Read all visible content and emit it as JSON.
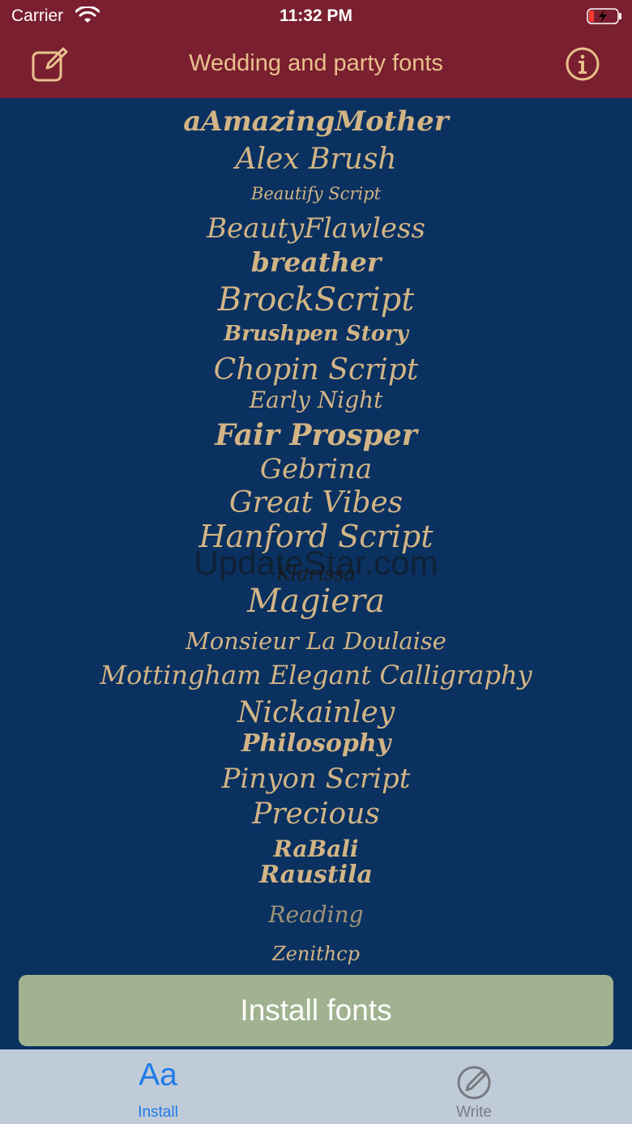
{
  "status_bar": {
    "carrier": "Carrier",
    "time": "11:32 PM",
    "icons": [
      "wifi-icon",
      "battery-charging-icon"
    ]
  },
  "nav": {
    "title": "Wedding and party fonts",
    "left_icon": "compose-icon",
    "right_icon": "info-icon"
  },
  "fonts": [
    {
      "name": "aAmazingMother"
    },
    {
      "name": "Alex Brush"
    },
    {
      "name": "Beautify Script"
    },
    {
      "name": "BeautyFlawless"
    },
    {
      "name": "breather"
    },
    {
      "name": "BrockScript"
    },
    {
      "name": "Brushpen Story"
    },
    {
      "name": "Chopin Script"
    },
    {
      "name": "Early Night"
    },
    {
      "name": "Fair Prosper"
    },
    {
      "name": "Gebrina"
    },
    {
      "name": "Great Vibes"
    },
    {
      "name": "Hanford Script"
    },
    {
      "name": "Klarissa"
    },
    {
      "name": "Magiera"
    },
    {
      "name": "Monsieur La Doulaise"
    },
    {
      "name": "Mottingham Elegant Calligraphy"
    },
    {
      "name": "Nickainley"
    },
    {
      "name": "Philosophy"
    },
    {
      "name": "Pinyon Script"
    },
    {
      "name": "Precious"
    },
    {
      "name": "RaBali"
    },
    {
      "name": "Raustila"
    },
    {
      "name": "Reading"
    },
    {
      "name": "Zenithcp"
    }
  ],
  "watermark": "UpdateStar.com",
  "install_button": "Install fonts",
  "tabs": [
    {
      "label": "Install",
      "glyph": "Aa",
      "icon": "font-aa-icon",
      "active": true
    },
    {
      "label": "Write",
      "icon": "pencil-circle-icon",
      "active": false
    }
  ],
  "colors": {
    "header": "#7a1f2f",
    "background": "#0a3160",
    "accent": "#e8c08d",
    "font_sample": "#d2b485",
    "install_button": "#a1b290",
    "tabbar": "#c0cbd8",
    "tab_active": "#1f7be8",
    "tab_inactive": "#777a80"
  }
}
